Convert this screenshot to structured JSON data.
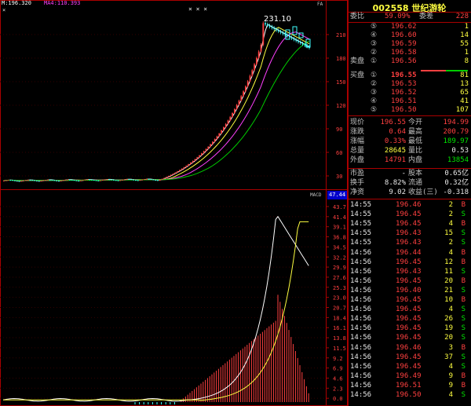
{
  "header": {
    "ma_label_1": "M:196.320",
    "ma_label_2": "MA4:110.393",
    "xx_marks": "× ×    ×",
    "peak_label": "231.10",
    "macd_label": "MACD",
    "macd_value": "47.44",
    "corner_left": "×",
    "corner_right": "FA"
  },
  "axes": {
    "price_ticks": [
      "210",
      "180",
      "150",
      "120",
      "90",
      "60",
      "30"
    ],
    "macd_ticks": [
      "43.7",
      "41.4",
      "39.1",
      "36.8",
      "34.5",
      "32.2",
      "29.9",
      "27.6",
      "25.3",
      "23.0",
      "20.7",
      "18.4",
      "16.1",
      "13.8",
      "11.5",
      "9.2",
      "6.9",
      "4.6",
      "2.3",
      "0.0"
    ]
  },
  "quote": {
    "title": "002558  世纪游轮",
    "committee_ratio_label": "委比",
    "committee_ratio": "59.09%",
    "committee_diff_label": "委差",
    "committee_diff": "228",
    "sell_side_label": "卖盘",
    "buy_side_label": "买盘",
    "asks": [
      {
        "level": "⑤",
        "price": "196.62",
        "vol": "1"
      },
      {
        "level": "④",
        "price": "196.60",
        "vol": "14"
      },
      {
        "level": "③",
        "price": "196.59",
        "vol": "55"
      },
      {
        "level": "②",
        "price": "196.58",
        "vol": "1"
      },
      {
        "level": "①",
        "price": "196.56",
        "vol": "8"
      }
    ],
    "bids": [
      {
        "level": "①",
        "price": "196.55",
        "vol": "81"
      },
      {
        "level": "②",
        "price": "196.53",
        "vol": "13"
      },
      {
        "level": "③",
        "price": "196.52",
        "vol": "65"
      },
      {
        "level": "④",
        "price": "196.51",
        "vol": "41"
      },
      {
        "level": "⑤",
        "price": "196.50",
        "vol": "107"
      }
    ],
    "stats": [
      {
        "l1": "现价",
        "v1": "196.55",
        "c1": "red",
        "l2": "今开",
        "v2": "194.99",
        "c2": "red"
      },
      {
        "l1": "涨跌",
        "v1": "0.64",
        "c1": "red",
        "l2": "最高",
        "v2": "200.79",
        "c2": "red"
      },
      {
        "l1": "涨幅",
        "v1": "0.33%",
        "c1": "red",
        "l2": "最低",
        "v2": "189.97",
        "c2": "green"
      },
      {
        "l1": "总量",
        "v1": "28645",
        "c1": "yellow",
        "l2": "量比",
        "v2": "0.53",
        "c2": "white"
      },
      {
        "l1": "外盘",
        "v1": "14791",
        "c1": "red",
        "l2": "内盘",
        "v2": "13854",
        "c2": "green"
      }
    ],
    "stats2": [
      {
        "l1": "市盈",
        "v1": "-",
        "l2": "股本",
        "v2": "0.65亿"
      },
      {
        "l1": "换手",
        "v1": "8.82%",
        "l2": "流通",
        "v2": "0.32亿"
      },
      {
        "l1": "净资",
        "v1": "9.02",
        "l2": "收益(三)",
        "v2": "-0.318"
      }
    ],
    "ticks": [
      {
        "t": "14:55",
        "p": "196.46",
        "v": "2",
        "s": "B"
      },
      {
        "t": "14:55",
        "p": "196.45",
        "v": "2",
        "s": "S"
      },
      {
        "t": "14:55",
        "p": "196.45",
        "v": "4",
        "s": "B"
      },
      {
        "t": "14:55",
        "p": "196.43",
        "v": "15",
        "s": "S"
      },
      {
        "t": "14:55",
        "p": "196.43",
        "v": "2",
        "s": "S"
      },
      {
        "t": "14:56",
        "p": "196.44",
        "v": "4",
        "s": "B"
      },
      {
        "t": "14:56",
        "p": "196.45",
        "v": "12",
        "s": "B"
      },
      {
        "t": "14:56",
        "p": "196.43",
        "v": "11",
        "s": "S"
      },
      {
        "t": "14:56",
        "p": "196.45",
        "v": "20",
        "s": "B"
      },
      {
        "t": "14:56",
        "p": "196.40",
        "v": "21",
        "s": "S"
      },
      {
        "t": "14:56",
        "p": "196.45",
        "v": "10",
        "s": "B"
      },
      {
        "t": "14:56",
        "p": "196.45",
        "v": "4",
        "s": "S"
      },
      {
        "t": "14:56",
        "p": "196.45",
        "v": "26",
        "s": "S"
      },
      {
        "t": "14:56",
        "p": "196.45",
        "v": "19",
        "s": "S"
      },
      {
        "t": "14:56",
        "p": "196.45",
        "v": "20",
        "s": "S"
      },
      {
        "t": "14:56",
        "p": "196.46",
        "v": "3",
        "s": "B"
      },
      {
        "t": "14:56",
        "p": "196.45",
        "v": "37",
        "s": "S"
      },
      {
        "t": "14:56",
        "p": "196.45",
        "v": "4",
        "s": "S"
      },
      {
        "t": "14:56",
        "p": "196.49",
        "v": "9",
        "s": "B"
      },
      {
        "t": "14:56",
        "p": "196.51",
        "v": "9",
        "s": "B"
      },
      {
        "t": "14:56",
        "p": "196.50",
        "v": "4",
        "s": "S"
      }
    ]
  },
  "colors": {
    "up": "#ff4040",
    "down": "#00e600",
    "ma1": "#ffffff",
    "ma2": "#ffff40",
    "ma3": "#ff40ff",
    "ma4": "#00cc00",
    "candle_up": "#40ffff",
    "border": "#aa0000"
  }
}
